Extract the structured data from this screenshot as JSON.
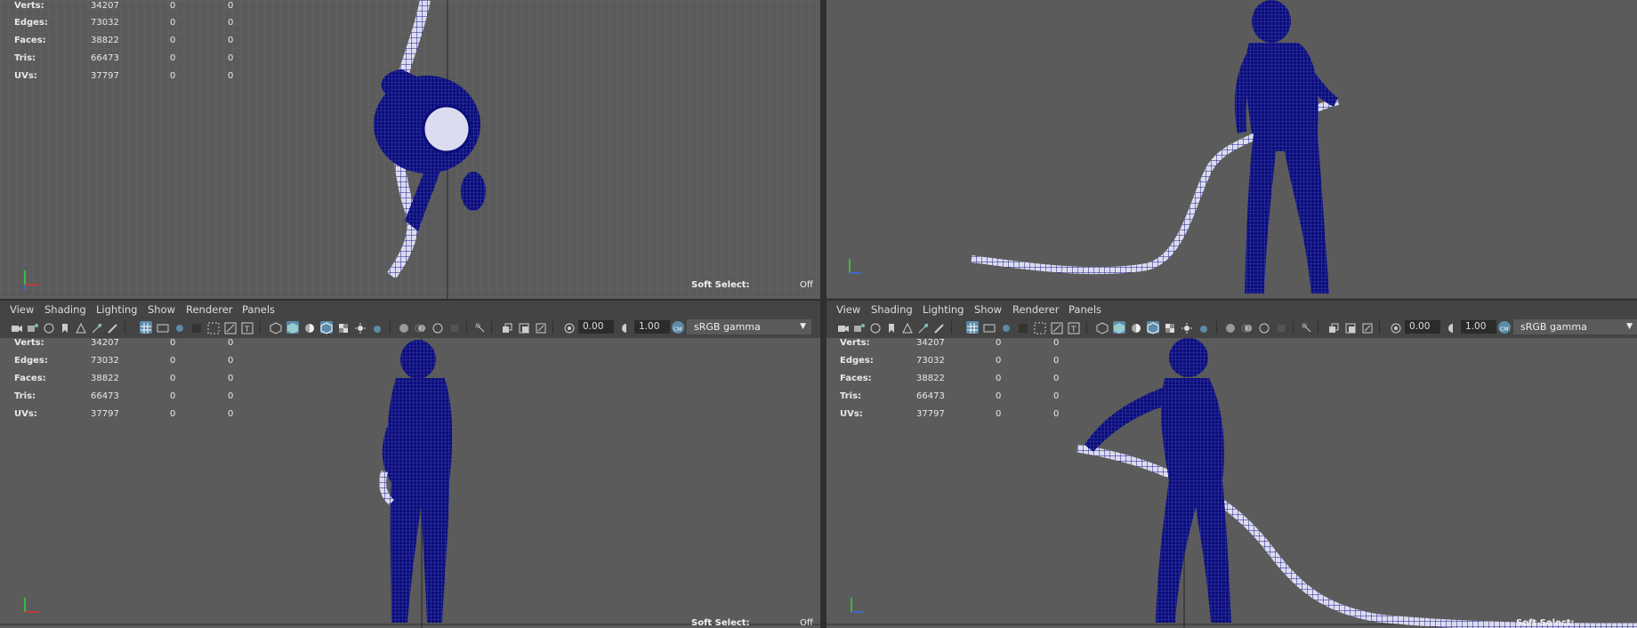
{
  "stats": {
    "rows": [
      {
        "label": "Verts:",
        "v0": "34207",
        "v1": "0",
        "v2": "0"
      },
      {
        "label": "Edges:",
        "v0": "73032",
        "v1": "0",
        "v2": "0"
      },
      {
        "label": "Faces:",
        "v0": "38822",
        "v1": "0",
        "v2": "0"
      },
      {
        "label": "Tris:",
        "v0": "66473",
        "v1": "0",
        "v2": "0"
      },
      {
        "label": "UVs:",
        "v0": "37797",
        "v1": "0",
        "v2": "0"
      }
    ]
  },
  "soft_select": {
    "label": "Soft Select:",
    "value": "Off"
  },
  "menu": {
    "view": "View",
    "shading": "Shading",
    "lighting": "Lighting",
    "show": "Show",
    "renderer": "Renderer",
    "panels": "Panels"
  },
  "toolbar": {
    "exposure": "0.00",
    "gamma": "1.00",
    "color_space": "sRGB gamma"
  },
  "colors": {
    "viewport_bg": "#5b5b5b",
    "mesh": "#0b0e7a",
    "grid": "#6a6a6a",
    "highlight": "#5c8aa8"
  },
  "icons": [
    "camera-icon",
    "film-icon",
    "bookmark-icon",
    "grid-icon",
    "shading-icon",
    "lights-icon",
    "exposure-icon",
    "gamma-icon",
    "colorspace-icon"
  ]
}
